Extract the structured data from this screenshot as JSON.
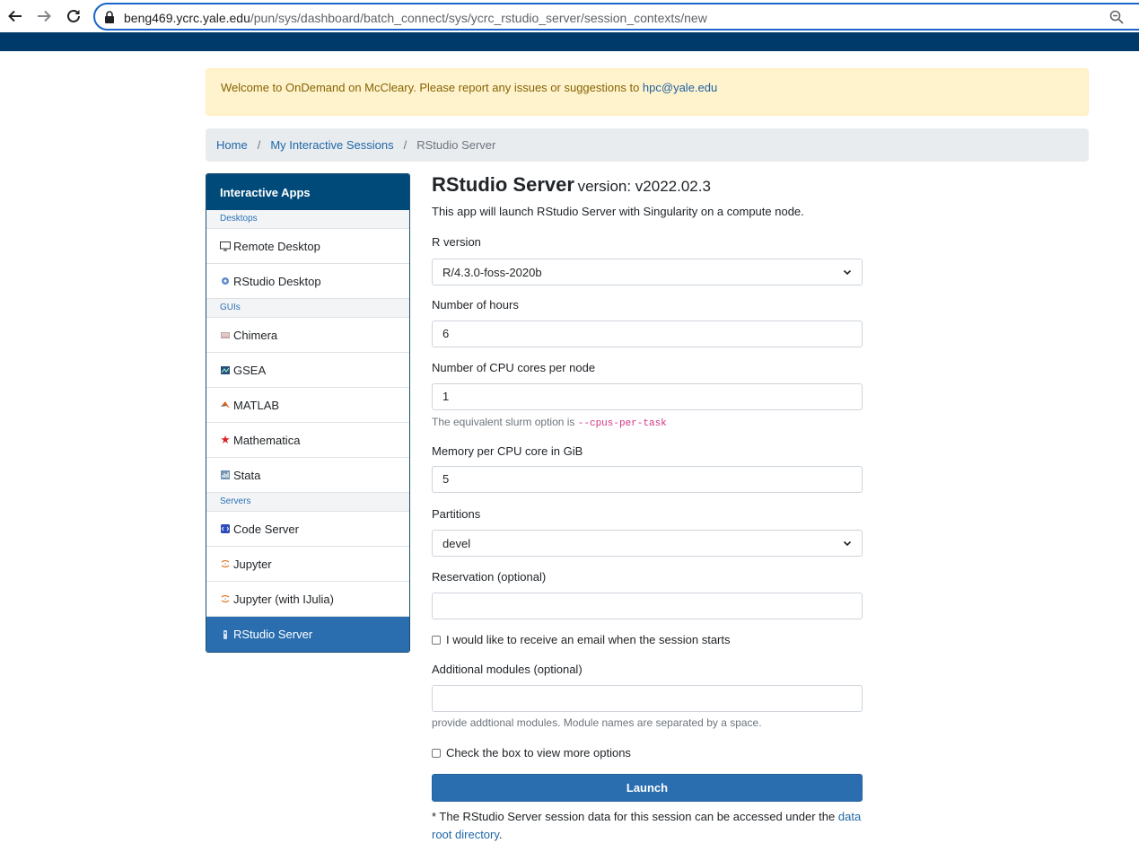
{
  "browser": {
    "url_host": "beng469.ycrc.yale.edu",
    "url_path": "/pun/sys/dashboard/batch_connect/sys/ycrc_rstudio_server/session_contexts/new"
  },
  "alert": {
    "text": "Welcome to OnDemand on McCleary. Please report any issues or suggestions to",
    "email": "hpc@yale.edu"
  },
  "breadcrumb": {
    "home": "Home",
    "sessions": "My Interactive Sessions",
    "current": "RStudio Server",
    "separator": "/"
  },
  "sidebar": {
    "heading": "Interactive Apps",
    "cat_desktops": "Desktops",
    "cat_guis": "GUIs",
    "cat_servers": "Servers",
    "items": [
      {
        "label": "Remote Desktop",
        "icon": "monitor-icon"
      },
      {
        "label": "RStudio Desktop",
        "icon": "rstudio-icon"
      },
      {
        "label": "Chimera",
        "icon": "chimera-icon"
      },
      {
        "label": "GSEA",
        "icon": "gsea-icon"
      },
      {
        "label": "MATLAB",
        "icon": "matlab-icon"
      },
      {
        "label": "Mathematica",
        "icon": "mathematica-icon"
      },
      {
        "label": "Stata",
        "icon": "stata-icon"
      },
      {
        "label": "Code Server",
        "icon": "code-server-icon"
      },
      {
        "label": "Jupyter",
        "icon": "jupyter-icon"
      },
      {
        "label": "Jupyter (with IJulia)",
        "icon": "jupyter-icon"
      },
      {
        "label": "RStudio Server",
        "icon": "rstudio-server-icon",
        "active": true
      }
    ]
  },
  "form": {
    "title": "RStudio Server",
    "version": "version: v2022.02.3",
    "description": "This app will launch RStudio Server with Singularity on a compute node.",
    "r_version_label": "R version",
    "r_version_value": "R/4.3.0-foss-2020b",
    "hours_label": "Number of hours",
    "hours_value": "6",
    "cpu_label": "Number of CPU cores per node",
    "cpu_value": "1",
    "cpu_help": "The equivalent slurm option is",
    "cpu_help_code": "--cpus-per-task",
    "mem_label": "Memory per CPU core in GiB",
    "mem_value": "5",
    "partition_label": "Partitions",
    "partition_value": "devel",
    "reservation_label": "Reservation (optional)",
    "reservation_value": "",
    "email_check_label": "I would like to receive an email when the session starts",
    "modules_label": "Additional modules (optional)",
    "modules_value": "",
    "modules_help": "provide addtional modules. Module names are separated by a space.",
    "more_options_label": "Check the box to view more options",
    "launch_label": "Launch",
    "note_prefix": "* The RStudio Server session data for this session can be accessed under the",
    "note_link": "data root directory",
    "note_suffix": "."
  }
}
